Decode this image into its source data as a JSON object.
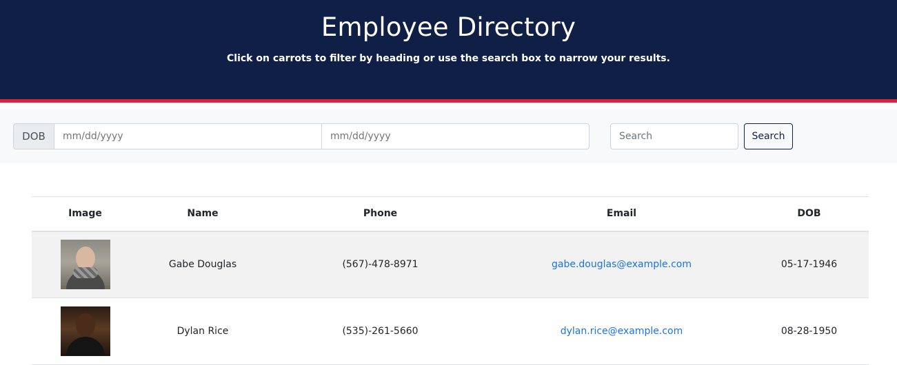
{
  "header": {
    "title": "Employee Directory",
    "subtitle": "Click on carrots to filter by heading or use the search box to narrow your results."
  },
  "filters": {
    "dob_label": "DOB",
    "date_start_placeholder": "mm/dd/yyyy",
    "date_end_placeholder": "mm/dd/yyyy",
    "search_placeholder": "Search",
    "search_button_label": "Search"
  },
  "table": {
    "columns": [
      "Image",
      "Name",
      "Phone",
      "Email",
      "DOB"
    ],
    "rows": [
      {
        "avatar": "employee-photo",
        "name": "Gabe Douglas",
        "phone": "(567)-478-8971",
        "email": "gabe.douglas@example.com",
        "dob": "05-17-1946"
      },
      {
        "avatar": "employee-photo",
        "name": "Dylan Rice",
        "phone": "(535)-261-5660",
        "email": "dylan.rice@example.com",
        "dob": "08-28-1950"
      }
    ]
  },
  "colors": {
    "header_bg": "#101f46",
    "header_accent": "#e0203c",
    "link": "#1a73e8"
  }
}
